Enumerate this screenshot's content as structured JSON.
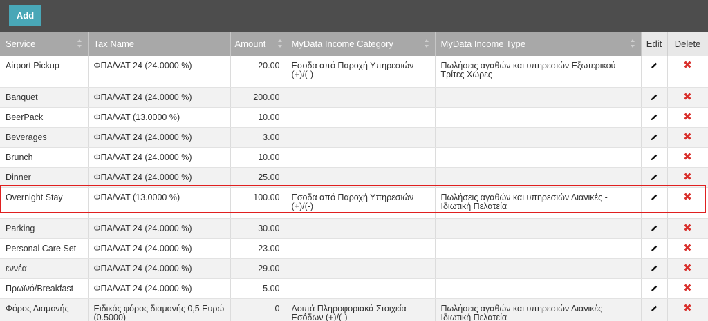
{
  "toolbar": {
    "add_label": "Add",
    "add_color": "#49a7b7",
    "bar_color": "#4d4d4d"
  },
  "table": {
    "columns": [
      {
        "key": "service",
        "label": "Service",
        "sortable": true
      },
      {
        "key": "tax_name",
        "label": "Tax Name",
        "sortable": false
      },
      {
        "key": "amount",
        "label": "Amount",
        "sortable": true
      },
      {
        "key": "income_category",
        "label": "MyData Income Category",
        "sortable": true
      },
      {
        "key": "income_type",
        "label": "MyData Income Type",
        "sortable": true
      },
      {
        "key": "edit",
        "label": "Edit",
        "sortable": false
      },
      {
        "key": "delete",
        "label": "Delete",
        "sortable": false
      }
    ],
    "rows": [
      {
        "service": "Airport Pickup",
        "tax_name": "ΦΠΑ/VAT 24 (24.0000 %)",
        "amount": "20.00",
        "income_category": "Εσοδα από Παροχή Υπηρεσιών (+)/(-)",
        "income_type": "Πωλήσεις αγαθών και υπηρεσιών Εξωτερικού Τρίτες Χώρες"
      },
      {
        "service": "Banquet",
        "tax_name": "ΦΠΑ/VAT 24 (24.0000 %)",
        "amount": "200.00",
        "income_category": "",
        "income_type": ""
      },
      {
        "service": "BeerPack",
        "tax_name": "ΦΠΑ/VAT (13.0000 %)",
        "amount": "10.00",
        "income_category": "",
        "income_type": ""
      },
      {
        "service": "Beverages",
        "tax_name": "ΦΠΑ/VAT 24 (24.0000 %)",
        "amount": "3.00",
        "income_category": "",
        "income_type": ""
      },
      {
        "service": "Brunch",
        "tax_name": "ΦΠΑ/VAT 24 (24.0000 %)",
        "amount": "10.00",
        "income_category": "",
        "income_type": ""
      },
      {
        "service": "Dinner",
        "tax_name": "ΦΠΑ/VAT 24 (24.0000 %)",
        "amount": "25.00",
        "income_category": "",
        "income_type": ""
      },
      {
        "service": "Overnight Stay",
        "tax_name": "ΦΠΑ/VAT (13.0000 %)",
        "amount": "100.00",
        "income_category": "Εσοδα από Παροχή Υπηρεσιών (+)/(-)",
        "income_type": "Πωλήσεις αγαθών και υπηρεσιών Λιανικές - Ιδιωτική Πελατεία",
        "highlighted": true
      },
      {
        "service": "Parking",
        "tax_name": "ΦΠΑ/VAT 24 (24.0000 %)",
        "amount": "30.00",
        "income_category": "",
        "income_type": ""
      },
      {
        "service": "Personal Care Set",
        "tax_name": "ΦΠΑ/VAT 24 (24.0000 %)",
        "amount": "23.00",
        "income_category": "",
        "income_type": ""
      },
      {
        "service": "εννέα",
        "tax_name": "ΦΠΑ/VAT 24 (24.0000 %)",
        "amount": "29.00",
        "income_category": "",
        "income_type": ""
      },
      {
        "service": "Πρωϊνό/Breakfast",
        "tax_name": "ΦΠΑ/VAT 24 (24.0000 %)",
        "amount": "5.00",
        "income_category": "",
        "income_type": ""
      },
      {
        "service": "Φόρος Διαμονής",
        "tax_name": "Ειδικός φόρος διαμονής 0,5 Ευρώ (0.5000)",
        "amount": "0",
        "income_category": "Λοιπά Πληροφοριακά Στοιχεία Εσόδων (+)/(-)",
        "income_type": "Πωλήσεις αγαθών και υπηρεσιών Λιανικές - Ιδιωτική Πελατεία"
      }
    ]
  },
  "icons": {
    "edit": "pencil-icon",
    "delete": "close-x-icon"
  },
  "colors": {
    "header_bg": "#a8a8a8",
    "delete_icon": "#d9302c",
    "highlight_border": "#e02020"
  }
}
